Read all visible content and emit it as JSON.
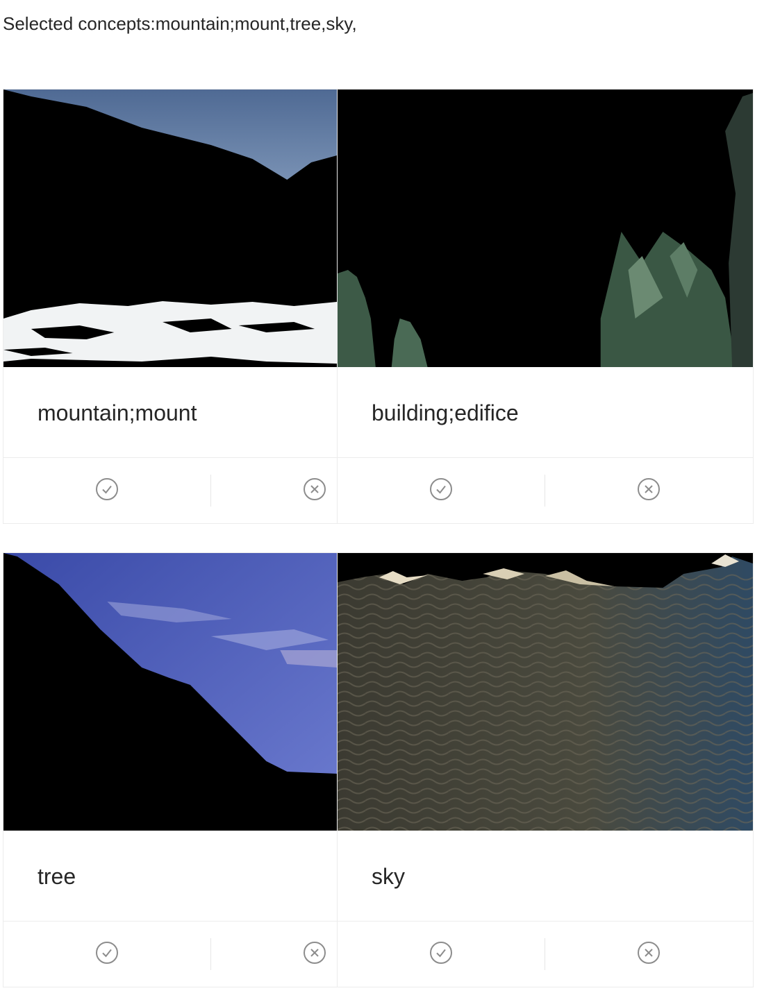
{
  "header": {
    "selected_concepts_text": "Selected concepts:mountain;mount,tree,sky,"
  },
  "cards": [
    {
      "title": "mountain;mount",
      "image": "mountain silhouette with lake at dusk",
      "actions": [
        "check-circle-icon",
        "close-circle-icon"
      ]
    },
    {
      "title": "building;edifice",
      "image": "dark scene with pine trees",
      "actions": [
        "check-circle-icon",
        "close-circle-icon"
      ]
    },
    {
      "title": "tree",
      "image": "dark mountain slope against blue sky",
      "actions": [
        "check-circle-icon",
        "close-circle-icon"
      ]
    },
    {
      "title": "sky",
      "image": "rippled water surface with dark band above",
      "actions": [
        "check-circle-icon",
        "close-circle-icon"
      ]
    }
  ],
  "colors": {
    "icon": "#8c8c8c",
    "border": "#ececec",
    "text": "#262626"
  }
}
